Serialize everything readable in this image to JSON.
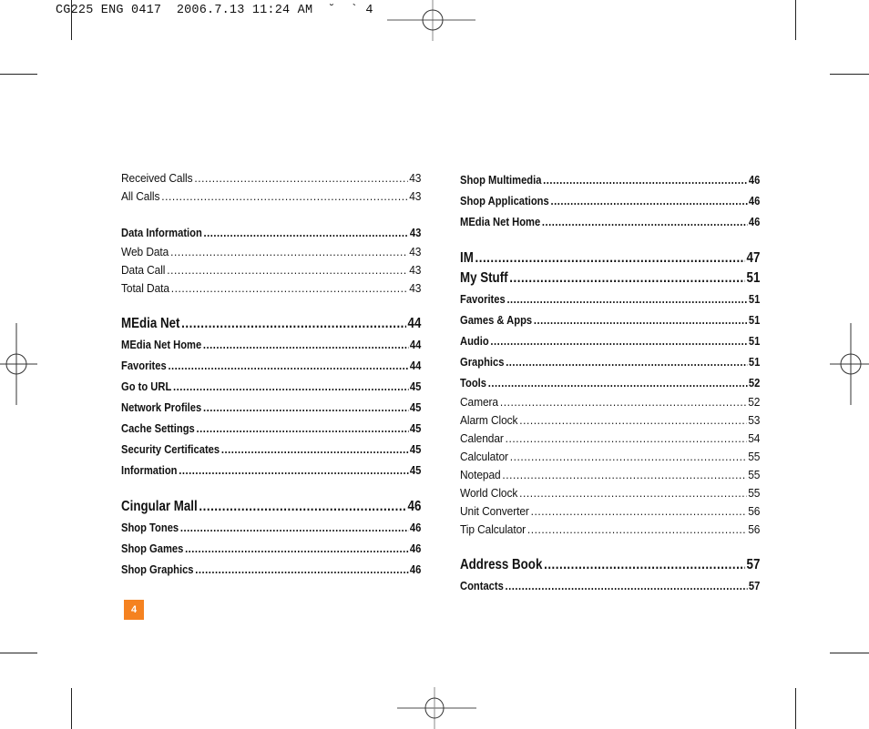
{
  "slug": "CG225 ENG 0417  2006.7.13 11:24 AM  ˘  ` 4",
  "page_number": "4",
  "colors": {
    "badge": "#f58220",
    "text": "#111111",
    "marks": "#222222"
  },
  "left_column": [
    {
      "label": "Received Calls",
      "page": "43",
      "style": "sub"
    },
    {
      "label": "All Calls",
      "page": "43",
      "style": "sub"
    },
    {
      "gap": true
    },
    {
      "label": "Data Information",
      "page": "43",
      "style": "bold"
    },
    {
      "label": "Web Data",
      "page": "43",
      "style": "sub"
    },
    {
      "label": "Data Call",
      "page": "43",
      "style": "sub"
    },
    {
      "label": "Total Data",
      "page": "43",
      "style": "sub"
    },
    {
      "gap": true
    },
    {
      "label": "MEdia Net",
      "page": "44",
      "style": "head"
    },
    {
      "label": "MEdia Net Home",
      "page": "44",
      "style": "bold"
    },
    {
      "label": "Favorites",
      "page": "44",
      "style": "bold"
    },
    {
      "label": "Go to URL",
      "page": "45",
      "style": "bold"
    },
    {
      "label": "Network Profiles",
      "page": "45",
      "style": "bold"
    },
    {
      "label": "Cache Settings",
      "page": "45",
      "style": "bold"
    },
    {
      "label": "Security Certificates",
      "page": "45",
      "style": "bold"
    },
    {
      "label": "Information",
      "page": "45",
      "style": "bold"
    },
    {
      "gap": true
    },
    {
      "label": "Cingular Mall",
      "page": "46",
      "style": "head"
    },
    {
      "label": "Shop Tones",
      "page": "46",
      "style": "bold"
    },
    {
      "label": "Shop Games",
      "page": "46",
      "style": "bold"
    },
    {
      "label": "Shop Graphics",
      "page": "46",
      "style": "bold"
    }
  ],
  "right_column": [
    {
      "label": "Shop Multimedia",
      "page": "46",
      "style": "bold"
    },
    {
      "label": "Shop Applications",
      "page": "46",
      "style": "bold"
    },
    {
      "label": "MEdia Net Home",
      "page": "46",
      "style": "bold"
    },
    {
      "gap": true
    },
    {
      "label": "IM",
      "page": "47",
      "style": "head"
    },
    {
      "label": "My Stuff",
      "page": "51",
      "style": "head"
    },
    {
      "label": "Favorites",
      "page": "51",
      "style": "bold"
    },
    {
      "label": "Games & Apps",
      "page": "51",
      "style": "bold"
    },
    {
      "label": "Audio",
      "page": "51",
      "style": "bold"
    },
    {
      "label": "Graphics",
      "page": "51",
      "style": "bold"
    },
    {
      "label": "Tools",
      "page": "52",
      "style": "bold"
    },
    {
      "label": "Camera",
      "page": "52",
      "style": "sub"
    },
    {
      "label": "Alarm Clock",
      "page": "53",
      "style": "sub"
    },
    {
      "label": "Calendar",
      "page": "54",
      "style": "sub"
    },
    {
      "label": "Calculator",
      "page": "55",
      "style": "sub"
    },
    {
      "label": "Notepad",
      "page": "55",
      "style": "sub"
    },
    {
      "label": "World Clock",
      "page": "55",
      "style": "sub"
    },
    {
      "label": "Unit Converter",
      "page": "56",
      "style": "sub"
    },
    {
      "label": "Tip Calculator",
      "page": "56",
      "style": "sub"
    },
    {
      "gap": true
    },
    {
      "label": "Address Book",
      "page": "57",
      "style": "head"
    },
    {
      "label": "Contacts",
      "page": "57",
      "style": "bold"
    }
  ]
}
